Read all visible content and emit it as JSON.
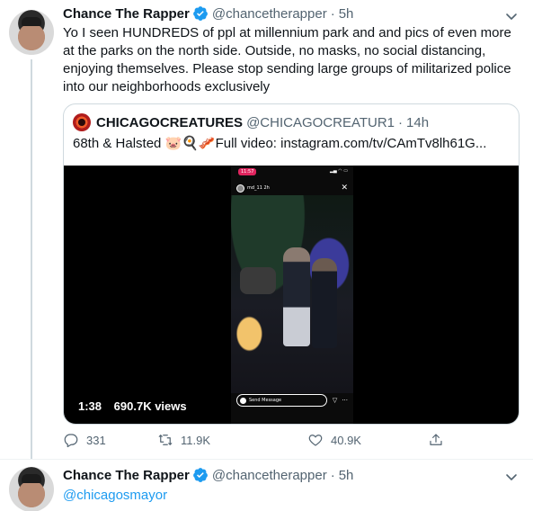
{
  "tweet1": {
    "name": "Chance The Rapper",
    "handle": "@chancetherapper",
    "separator": "·",
    "time": "5h",
    "text": "Yo I seen HUNDREDS of ppl at millennium park and and pics of even more at the parks on the north side. Outside, no masks, no social distancing, enjoying themselves. Please stop sending large groups of militarized police into our neighborhoods exclusively",
    "quote": {
      "name": "CHICAGOCREATURES",
      "handle": "@CHICAGOCREATUR1",
      "separator": "·",
      "time": "14h",
      "text": "68th & Halsted 🐷🍳🥓Full video: instagram.com/tv/CAmTv8lh61G...",
      "video": {
        "duration": "1:38",
        "views": "690.7K views",
        "phone_status_time": "11:57",
        "story_user": "md_11 2h",
        "message_placeholder": "Send Message"
      }
    },
    "actions": {
      "replies": "331",
      "retweets": "11.9K",
      "likes": "40.9K"
    }
  },
  "tweet2": {
    "name": "Chance The Rapper",
    "handle": "@chancetherapper",
    "separator": "·",
    "time": "5h",
    "text": "@chicagosmayor"
  },
  "colors": {
    "verified": "#1d9bf0",
    "link": "#1d9bf0",
    "secondary_text": "#536471"
  },
  "icons": [
    "verified-badge-icon",
    "chevron-down-icon",
    "reply-icon",
    "retweet-icon",
    "like-icon",
    "share-icon"
  ]
}
